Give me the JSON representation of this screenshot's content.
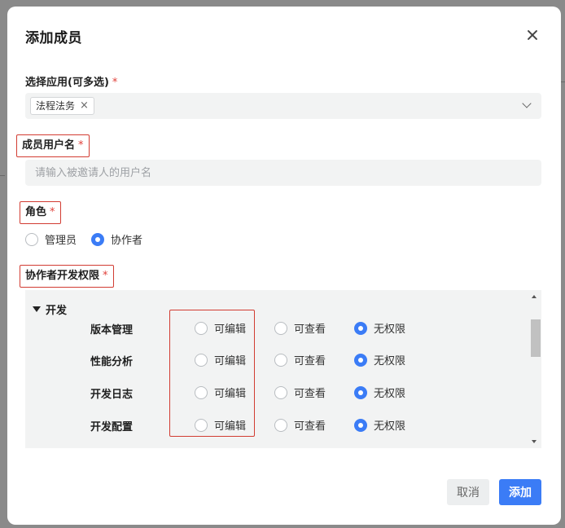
{
  "dialog": {
    "title": "添加成员",
    "close_icon": "close-icon"
  },
  "apps_field": {
    "label": "选择应用(可多选)",
    "required_mark": "*",
    "selected_tags": [
      {
        "label": "法程法务",
        "remove_icon": "×"
      }
    ]
  },
  "username_field": {
    "label": "成员用户名",
    "required_mark": "*",
    "value": "",
    "placeholder": "请输入被邀请人的用户名"
  },
  "role_field": {
    "label": "角色",
    "required_mark": "*",
    "options": [
      {
        "label": "管理员",
        "checked": false
      },
      {
        "label": "协作者",
        "checked": true
      }
    ]
  },
  "permissions_field": {
    "label": "协作者开发权限",
    "required_mark": "*",
    "group": "开发",
    "option_labels": [
      "可编辑",
      "可查看",
      "无权限"
    ],
    "rows": [
      {
        "name": "版本管理",
        "selected": "无权限"
      },
      {
        "name": "性能分析",
        "selected": "无权限"
      },
      {
        "name": "开发日志",
        "selected": "无权限"
      },
      {
        "name": "开发配置",
        "selected": "无权限"
      }
    ]
  },
  "footer": {
    "cancel_label": "取消",
    "submit_label": "添加"
  },
  "colors": {
    "accent": "#3b7cf6",
    "required": "#e0403a",
    "highlight_border": "#d23c32",
    "field_bg": "#f2f3f3"
  }
}
